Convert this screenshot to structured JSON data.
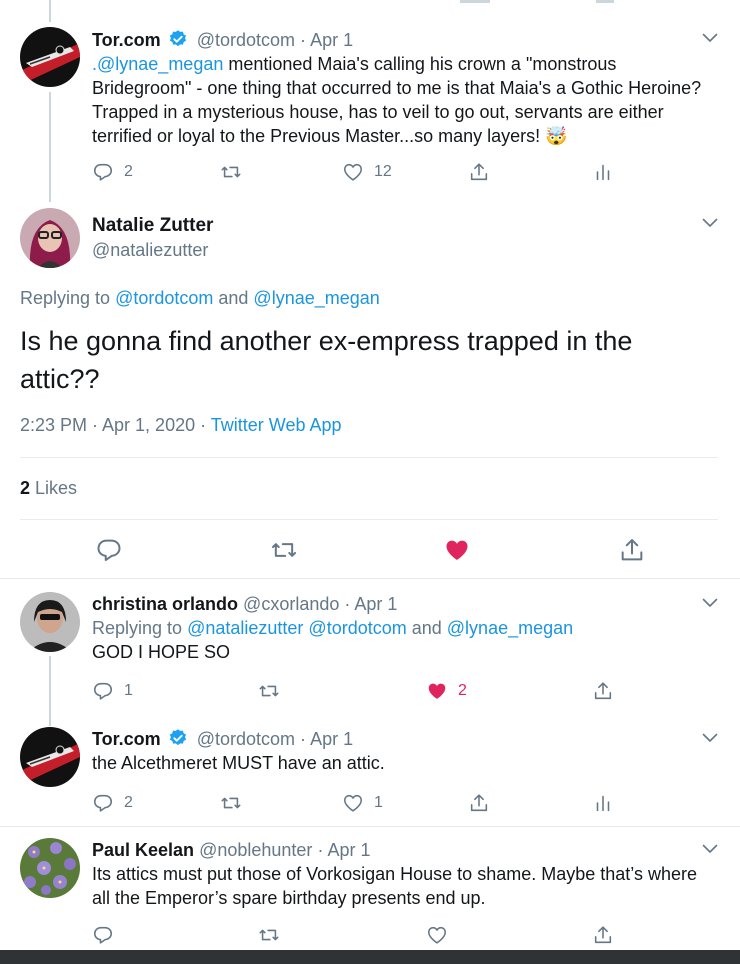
{
  "colors": {
    "link": "#1b95e0",
    "secondary": "#657786",
    "like": "#e0245e",
    "divider": "#e6ecf0"
  },
  "tweets": {
    "tor1": {
      "name": "Tor.com",
      "handle": "@tordotcom",
      "dot": "·",
      "date": "Apr 1",
      "mention": ".@lynae_megan",
      "text": " mentioned Maia's calling his crown a \"monstrous Bridegroom\" - one thing that occurred to me is that Maia's a Gothic Heroine? Trapped in a mysterious house, has to veil to go out, servants are either terrified or loyal to the Previous Master...so many layers! 🤯",
      "replies": "2",
      "retweets": "",
      "likes": "12"
    },
    "main": {
      "name": "Natalie Zutter",
      "handle": "@nataliezutter",
      "replying_prefix": "Replying to ",
      "replying_1": "@tordotcom",
      "replying_and": " and ",
      "replying_2": "@lynae_megan",
      "text": "Is he gonna find another ex-empress trapped in the attic??",
      "time": "2:23 PM · Apr 1, 2020 · ",
      "app": "Twitter Web App",
      "likes_count": "2",
      "likes_label": " Likes"
    },
    "christina": {
      "name": "christina orlando",
      "handle": "@cxorlando",
      "dot": "·",
      "date": "Apr 1",
      "replying_prefix": "Replying to ",
      "replying_1": "@nataliezutter",
      "replying_2": "@tordotcom",
      "replying_and": " and ",
      "replying_3": "@lynae_megan",
      "text": "GOD I HOPE SO",
      "replies": "1",
      "likes": "2"
    },
    "tor2": {
      "name": "Tor.com",
      "handle": "@tordotcom",
      "dot": "·",
      "date": "Apr 1",
      "text": "the Alcethmeret MUST have an attic.",
      "replies": "2",
      "likes": "1"
    },
    "paul": {
      "name": "Paul Keelan",
      "handle": "@noblehunter",
      "dot": "·",
      "date": "Apr 1",
      "text": "Its attics must put those of Vorkosigan House to shame. Maybe that’s where all the Emperor’s spare birthday presents end up."
    }
  },
  "icons": [
    "reply-icon",
    "retweet-icon",
    "like-icon",
    "share-icon",
    "analytics-icon",
    "verified-icon",
    "chevron-down-icon"
  ]
}
